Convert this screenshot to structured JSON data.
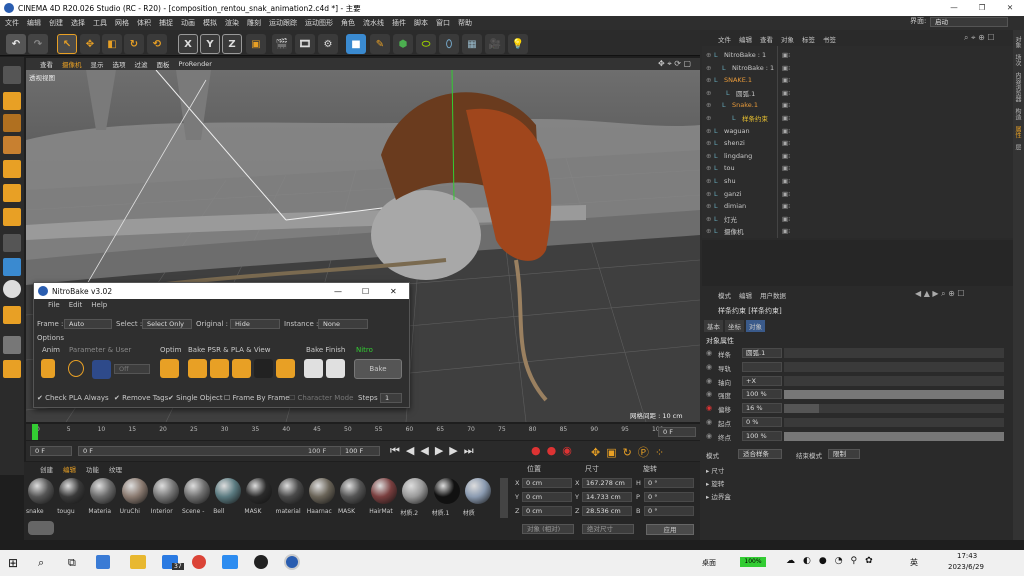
{
  "window": {
    "title": "CINEMA 4D R20.026 Studio (RC - R20) - [composition_rentou_snak_animation2.c4d *] - 主要"
  },
  "menubar": [
    "文件",
    "编辑",
    "创建",
    "选择",
    "工具",
    "网格",
    "体积",
    "捕捉",
    "动画",
    "模拟",
    "渲染",
    "雕刻",
    "运动跟踪",
    "运动图形",
    "角色",
    "流水线",
    "插件",
    "脚本",
    "窗口",
    "帮助"
  ],
  "layout": {
    "label": "界面:",
    "value": "启动"
  },
  "viewport": {
    "menu": [
      "查看",
      "摄像机",
      "显示",
      "选项",
      "过滤",
      "面板",
      "ProRender"
    ],
    "view_name": "透视视图",
    "grid_spacing": "网格间距 : 10 cm"
  },
  "timeline": {
    "ticks": [
      "0",
      "5",
      "10",
      "15",
      "20",
      "25",
      "30",
      "35",
      "40",
      "45",
      "50",
      "55",
      "60",
      "65",
      "70",
      "75",
      "80",
      "85",
      "90",
      "95",
      "100"
    ],
    "end_frame": "0 F"
  },
  "transport": {
    "start": "0 F",
    "current": "0 F",
    "max": "100 F",
    "end": "100 F"
  },
  "materials": {
    "tabs": [
      "创建",
      "编辑",
      "功能",
      "纹理"
    ],
    "items": [
      "snake",
      "tougu",
      "Materia",
      "UruChi",
      "Interior",
      "Scene -",
      "Bell",
      "MASK",
      "material",
      "Haarnac",
      "MASK",
      "HairMat",
      "材质.2",
      "材质.1",
      "材质"
    ],
    "colors": [
      "#555",
      "#3a3a3a",
      "#6b6b6b",
      "#8a7a70",
      "#777",
      "#707070",
      "#5a7a80",
      "#2a2a2a",
      "#4a4a4a",
      "#6a6458",
      "#555",
      "#7a3f3f",
      "#9a9a9a",
      "#111",
      "#8a9ab0"
    ]
  },
  "coords": {
    "headers": [
      "位置",
      "尺寸",
      "旋转"
    ],
    "rows": [
      {
        "axis": "X",
        "pos": "0 cm",
        "size": "167.278 cm",
        "rl": "H",
        "rot": "0 °"
      },
      {
        "axis": "Y",
        "pos": "0 cm",
        "size": "14.733 cm",
        "rl": "P",
        "rot": "0 °"
      },
      {
        "axis": "Z",
        "pos": "0 cm",
        "size": "28.536 cm",
        "rl": "B",
        "rot": "0 °"
      }
    ],
    "mode1": "对象 (相对)",
    "mode2": "绝对尺寸",
    "apply": "应用"
  },
  "objects": {
    "tabs": [
      "文件",
      "编辑",
      "查看",
      "对象",
      "标签",
      "书签"
    ],
    "items": [
      {
        "name": "NitroBake : 1",
        "color": "#c8c8c8"
      },
      {
        "name": "NitroBake : 1",
        "color": "#c8c8c8"
      },
      {
        "name": "SNAKE.1",
        "color": "#e89a3a"
      },
      {
        "name": "圆弧.1",
        "color": "#c8c8c8"
      },
      {
        "name": "Snake.1",
        "color": "#e89a3a"
      },
      {
        "name": "样条约束",
        "color": "#e8c030"
      },
      {
        "name": "waguan",
        "color": "#c8c8c8"
      },
      {
        "name": "shenzi",
        "color": "#c8c8c8"
      },
      {
        "name": "lingdang",
        "color": "#c8c8c8"
      },
      {
        "name": "tou",
        "color": "#c8c8c8"
      },
      {
        "name": "shu",
        "color": "#c8c8c8"
      },
      {
        "name": "ganzi",
        "color": "#c8c8c8"
      },
      {
        "name": "dimian",
        "color": "#c8c8c8"
      },
      {
        "name": "灯光",
        "color": "#c8c8c8"
      },
      {
        "name": "摄像机",
        "color": "#c8c8c8"
      }
    ]
  },
  "attributes": {
    "tabs": [
      "模式",
      "编辑",
      "用户数据"
    ],
    "title": "样条约束 [样条约束]",
    "subtabs": [
      "基本",
      "坐标",
      "对象"
    ],
    "section": "对象属性",
    "rows": [
      {
        "label": "样条",
        "value": "圆弧.1"
      },
      {
        "label": "导轨",
        "value": ""
      },
      {
        "label": "轴向",
        "value": "+X"
      },
      {
        "label": "强度",
        "value": "100 %"
      },
      {
        "label": "偏移",
        "value": "16 %"
      },
      {
        "label": "起点",
        "value": "0 %"
      },
      {
        "label": "终点",
        "value": "100 %"
      }
    ],
    "offset_level": 0.16,
    "mode_label": "模式",
    "mode_value": "适合样条",
    "end_label": "结束模式",
    "end_value": "限制",
    "groups": [
      "尺寸",
      "旋转",
      "边界盒"
    ]
  },
  "side_tabs": [
    "对象",
    "场次",
    "内容浏览器",
    "构造",
    "属性",
    "层"
  ],
  "dialog": {
    "title": "NitroBake v3.02",
    "menu": [
      "File",
      "Edit",
      "Help"
    ],
    "frame_label": "Frame :",
    "frame_value": "Auto",
    "select_label": "Select :",
    "select_value": "Select Only",
    "original_label": "Original :",
    "original_value": "Hide",
    "instance_label": "Instance :",
    "instance_value": "None",
    "options": "Options",
    "anim": "Anim",
    "param": "Parameter & User",
    "optim": "Optim",
    "psr": "Bake PSR & PLA & View",
    "finish": "Bake Finish",
    "nitro": "Nitro",
    "off": "Off",
    "bake": "Bake",
    "check1": "Check PLA Always",
    "check2": "Remove Tags",
    "check3": "Single Object",
    "check4": "Frame By Frame",
    "check5": "Character Mode",
    "steps_label": "Steps",
    "steps_value": "1"
  },
  "taskbar": {
    "desktop": "桌面",
    "battery": "100%",
    "ime": "英",
    "time": "17:43",
    "date": "2023/6/29",
    "badge": "37"
  }
}
